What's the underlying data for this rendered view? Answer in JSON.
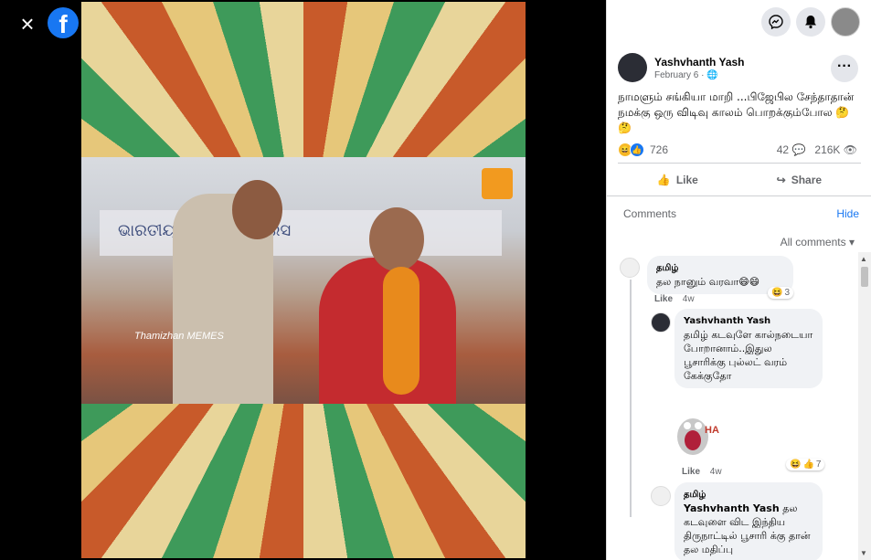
{
  "media": {
    "close_icon": "×",
    "logo_letter": "f",
    "banner_text": "ଭାରତୀୟ ଜାତୀୟ କଂଗ୍ରେସ",
    "watermark": "Thamizhan MEMES"
  },
  "post": {
    "author": "Yashvhanth Yash",
    "date": "February 6 · ",
    "text": "நாமளும் சங்கியா மாறி ...பிஜேபில சேந்தாதான் நமக்கு ஒரு விடிவு காலம் பொறக்கும்போல 🤔🤔",
    "reaction_count": "726",
    "comment_count": "42",
    "view_count": "216K",
    "like_label": "Like",
    "share_label": "Share"
  },
  "comments_panel": {
    "label": "Comments",
    "hide": "Hide",
    "filter": "All comments"
  },
  "comments": [
    {
      "author": "தமிழ்",
      "text": "தல நானும் வரவா😄😄",
      "like": "Like",
      "time": "4w",
      "reactions": "3"
    },
    {
      "author": "Yashvhanth Yash",
      "text": "தமிழ் கடவுளே கால்நடையா போறானாம்..இதுல பூசாரிக்கு புல்லட் வரம் கேக்குதோ",
      "like": "Like",
      "time": "4w",
      "reactions": "7",
      "sticker": "HA HA"
    },
    {
      "author": "தமிழ்",
      "mention": "Yashvhanth Yash",
      "text": "தல கடவுளை விட இந்திய திருநாட்டில் பூசாரி க்கு தான் தல மதிப்பு"
    }
  ],
  "colors": {
    "accent": "#1877f2",
    "media_bg": "#000000"
  }
}
